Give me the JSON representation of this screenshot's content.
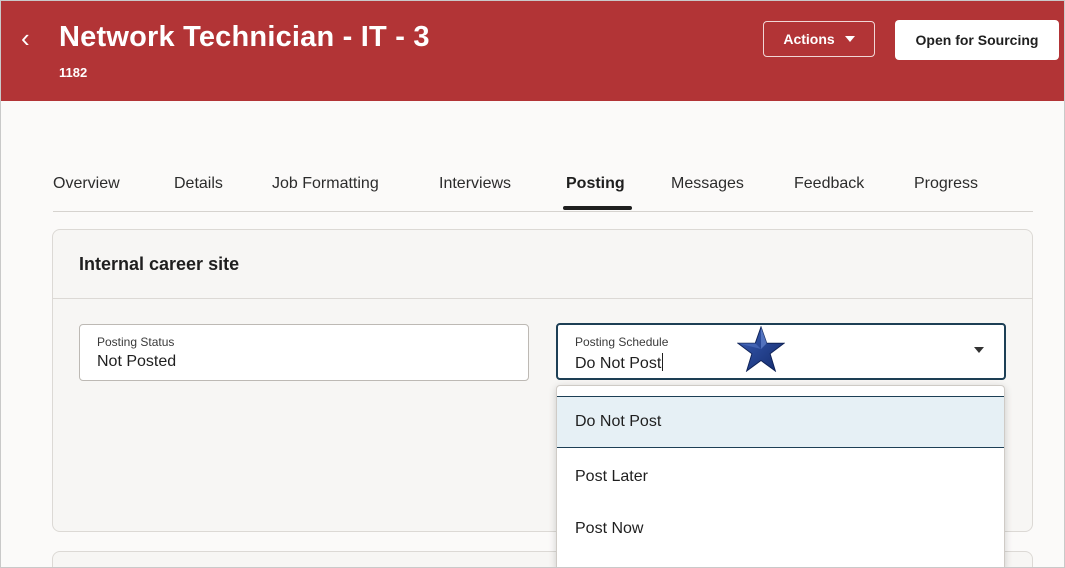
{
  "header": {
    "back_glyph": "‹",
    "title": "Network Technician - IT - 3",
    "requisition_id": "1182",
    "actions_label": "Actions",
    "open_label": "Open for Sourcing",
    "brand_color": "#b23436"
  },
  "tabs": [
    {
      "label": "Overview",
      "active": false
    },
    {
      "label": "Details",
      "active": false
    },
    {
      "label": "Job Formatting",
      "active": false
    },
    {
      "label": "Interviews",
      "active": false
    },
    {
      "label": "Posting",
      "active": true
    },
    {
      "label": "Messages",
      "active": false
    },
    {
      "label": "Feedback",
      "active": false
    },
    {
      "label": "Progress",
      "active": false
    }
  ],
  "section": {
    "title": "Internal career site",
    "posting_status": {
      "label": "Posting Status",
      "value": "Not Posted"
    },
    "posting_schedule": {
      "label": "Posting Schedule",
      "value": "Do Not Post",
      "options": [
        "Do Not Post",
        "Post Later",
        "Post Now"
      ],
      "selected_index": 0
    }
  },
  "icons": {
    "back": "chevron-left-icon",
    "dropdown": "chevron-down-icon",
    "annotation": "star-icon"
  }
}
